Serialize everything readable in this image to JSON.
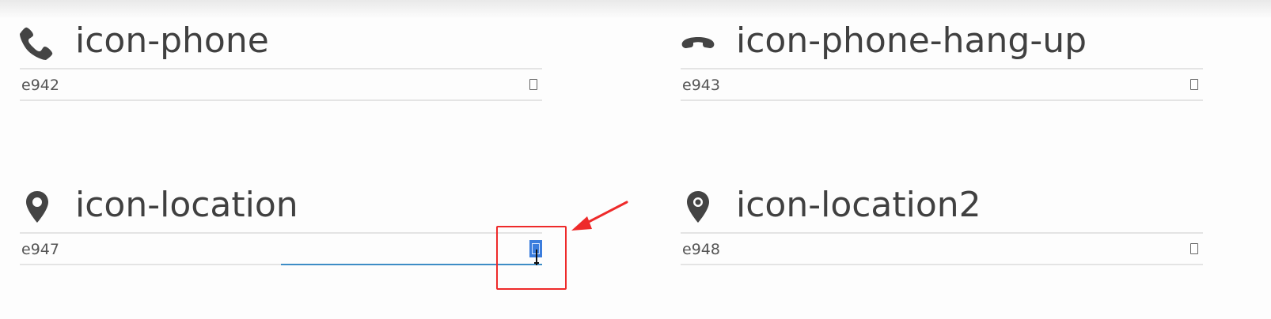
{
  "glyphs": [
    {
      "name": "icon-phone",
      "code": "e942",
      "icon": "phone-icon",
      "focused": false
    },
    {
      "name": "icon-phone-hang-up",
      "code": "e943",
      "icon": "phone-hang-up-icon",
      "focused": false
    },
    {
      "name": "icon-location",
      "code": "e947",
      "icon": "location-icon",
      "focused": true
    },
    {
      "name": "icon-location2",
      "code": "e948",
      "icon": "location2-icon",
      "focused": false
    }
  ],
  "annotation": {
    "color": "#ee2a2a",
    "marker": "arrow-icon"
  },
  "colors": {
    "text": "#404040",
    "focus_line": "#3d8dc6",
    "selection": "#3b7ddd"
  }
}
